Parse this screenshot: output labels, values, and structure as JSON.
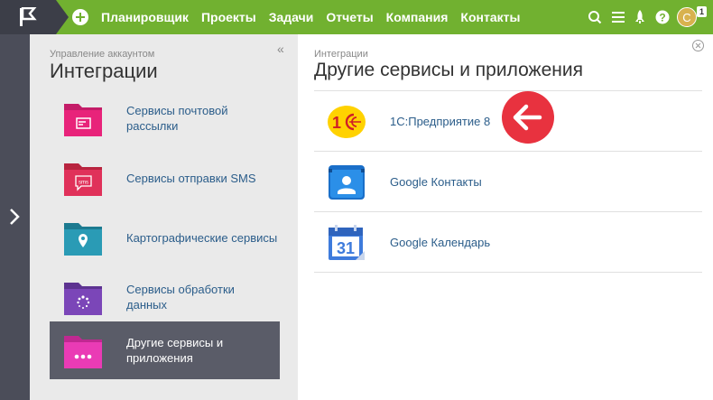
{
  "topbar": {
    "nav": [
      "Планировщик",
      "Проекты",
      "Задачи",
      "Отчеты",
      "Компания",
      "Контакты"
    ],
    "avatar_letter": "C",
    "notification_count": "1",
    "accent": "#71b130"
  },
  "left_panel": {
    "subtitle": "Управление аккаунтом",
    "title": "Интеграции",
    "items": [
      {
        "label": "Сервисы почтовой рассылки",
        "color": "#e8237a"
      },
      {
        "label": "Сервисы отправки SMS",
        "color": "#e0315a"
      },
      {
        "label": "Картографические сервисы",
        "color": "#2a9bb5"
      },
      {
        "label": "Сервисы обработки данных",
        "color": "#7b46b8"
      },
      {
        "label": "Другие сервисы и приложения",
        "color": "#ea3bb5"
      }
    ]
  },
  "right_panel": {
    "subtitle": "Интеграции",
    "title": "Другие сервисы и приложения",
    "services": [
      {
        "label": "1С:Предприятие 8",
        "icon": "1c-logo-icon"
      },
      {
        "label": "Google Контакты",
        "icon": "google-contacts-icon"
      },
      {
        "label": "Google Календарь",
        "icon": "google-calendar-icon"
      }
    ]
  }
}
